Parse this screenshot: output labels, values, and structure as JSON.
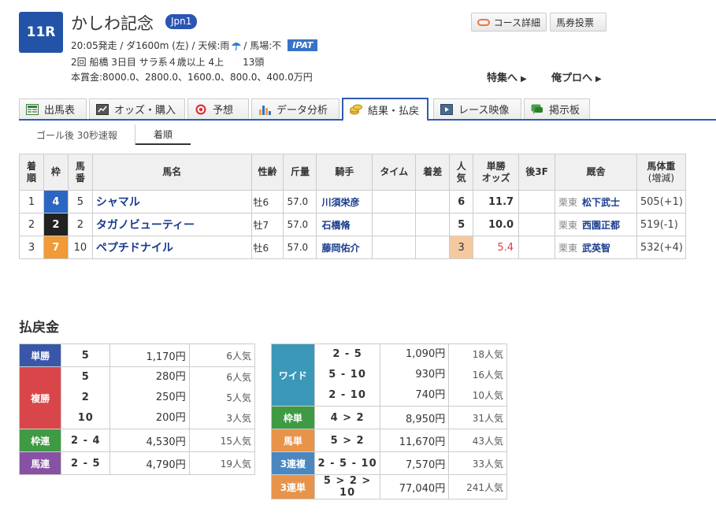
{
  "header": {
    "race_number": "11R",
    "race_name": "かしわ記念",
    "grade": "Jpn1",
    "data1_prefix": "20:05発走 / ダ1600m (左) / 天候:雨",
    "data1_suffix": "/ 馬場:不",
    "ipat": "IPAT",
    "data2": "2回 船橋 3日目 サラ系４歳以上 4上　　13頭",
    "data3": "本賞金:8000.0、2800.0、1600.0、800.0、400.0万円",
    "course_button": "コース詳細",
    "baken_button": "馬券投票",
    "feature_link": "特集へ",
    "orepro_link": "俺プロへ"
  },
  "tabs": [
    {
      "label": "出馬表",
      "icon": "table-icon"
    },
    {
      "label": "オッズ・購入",
      "icon": "odds-icon"
    },
    {
      "label": "予想",
      "icon": "target-icon"
    },
    {
      "label": "データ分析",
      "icon": "bar-chart-icon"
    },
    {
      "label": "結果・払戻",
      "icon": "coins-icon",
      "active": true
    },
    {
      "label": "レース映像",
      "icon": "video-icon"
    },
    {
      "label": "掲示板",
      "icon": "chat-icon"
    }
  ],
  "subtabs": [
    "ゴール後 30秒速報",
    "着順"
  ],
  "result": {
    "headers": {
      "rank": [
        "着",
        "順"
      ],
      "waku": "枠",
      "umaban": [
        "馬",
        "番"
      ],
      "name": "馬名",
      "sexage": "性齢",
      "kinryo": "斤量",
      "jockey": "騎手",
      "time": "タイム",
      "margin": "着差",
      "popularity": [
        "人",
        "気"
      ],
      "odds": [
        "単勝",
        "オッズ"
      ],
      "last3f": "後3F",
      "trainer": "厩舎",
      "weight": [
        "馬体重",
        "(増減)"
      ]
    },
    "rows": [
      {
        "rank": "1",
        "waku": "4",
        "waku_color": "#2b66c3",
        "umaban": "5",
        "name": "シャマル",
        "sexage": "牡6",
        "kinryo": "57.0",
        "jockey": "川須栄彦",
        "time": "",
        "margin": "",
        "popularity": "6",
        "odds": "11.7",
        "last3f": "",
        "trainer_area": "栗東",
        "trainer": "松下武士",
        "weight": "505(+1)"
      },
      {
        "rank": "2",
        "waku": "2",
        "waku_color": "#222222",
        "umaban": "2",
        "name": "タガノビューティー",
        "sexage": "牡7",
        "kinryo": "57.0",
        "jockey": "石橋脩",
        "time": "",
        "margin": "",
        "popularity": "5",
        "odds": "10.0",
        "last3f": "",
        "trainer_area": "栗東",
        "trainer": "西園正都",
        "weight": "519(-1)"
      },
      {
        "rank": "3",
        "waku": "7",
        "waku_color": "#f09a38",
        "umaban": "10",
        "name": "ペプチドナイル",
        "sexage": "牡6",
        "kinryo": "57.0",
        "jockey": "藤岡佑介",
        "time": "",
        "margin": "",
        "popularity": "3",
        "odds": "5.4",
        "last3f": "",
        "trainer_area": "栗東",
        "trainer": "武英智",
        "weight": "532(+4)"
      }
    ]
  },
  "payout": {
    "title": "払戻金",
    "left": [
      {
        "type": "単勝",
        "color": "#3a56a8",
        "entries": [
          {
            "num": "5",
            "amount": "1,170円",
            "ninki": "6人気"
          }
        ]
      },
      {
        "type": "複勝",
        "color": "#d9464a",
        "entries": [
          {
            "num": "5",
            "amount": "280円",
            "ninki": "6人気"
          },
          {
            "num": "2",
            "amount": "250円",
            "ninki": "5人気"
          },
          {
            "num": "10",
            "amount": "200円",
            "ninki": "3人気"
          }
        ]
      },
      {
        "type": "枠連",
        "color": "#3f9a44",
        "entries": [
          {
            "num": "2 - 4",
            "amount": "4,530円",
            "ninki": "15人気"
          }
        ]
      },
      {
        "type": "馬連",
        "color": "#8752a3",
        "entries": [
          {
            "num": "2 - 5",
            "amount": "4,790円",
            "ninki": "19人気"
          }
        ]
      }
    ],
    "right": [
      {
        "type": "ワイド",
        "color": "#3b98b8",
        "entries": [
          {
            "num": "2 - 5",
            "amount": "1,090円",
            "ninki": "18人気"
          },
          {
            "num": "5 - 10",
            "amount": "930円",
            "ninki": "16人気"
          },
          {
            "num": "2 - 10",
            "amount": "740円",
            "ninki": "10人気"
          }
        ]
      },
      {
        "type": "枠単",
        "color": "#3f9a44",
        "entries": [
          {
            "num": "4 > 2",
            "amount": "8,950円",
            "ninki": "31人気"
          }
        ]
      },
      {
        "type": "馬単",
        "color": "#e8934a",
        "entries": [
          {
            "num": "5 > 2",
            "amount": "11,670円",
            "ninki": "43人気"
          }
        ]
      },
      {
        "type": "3連複",
        "color": "#4a87c0",
        "entries": [
          {
            "num": "2 - 5 - 10",
            "amount": "7,570円",
            "ninki": "33人気"
          }
        ]
      },
      {
        "type": "3連単",
        "color": "#e8934a",
        "entries": [
          {
            "num": "5 > 2 > 10",
            "amount": "77,040円",
            "ninki": "241人気"
          }
        ]
      }
    ]
  }
}
